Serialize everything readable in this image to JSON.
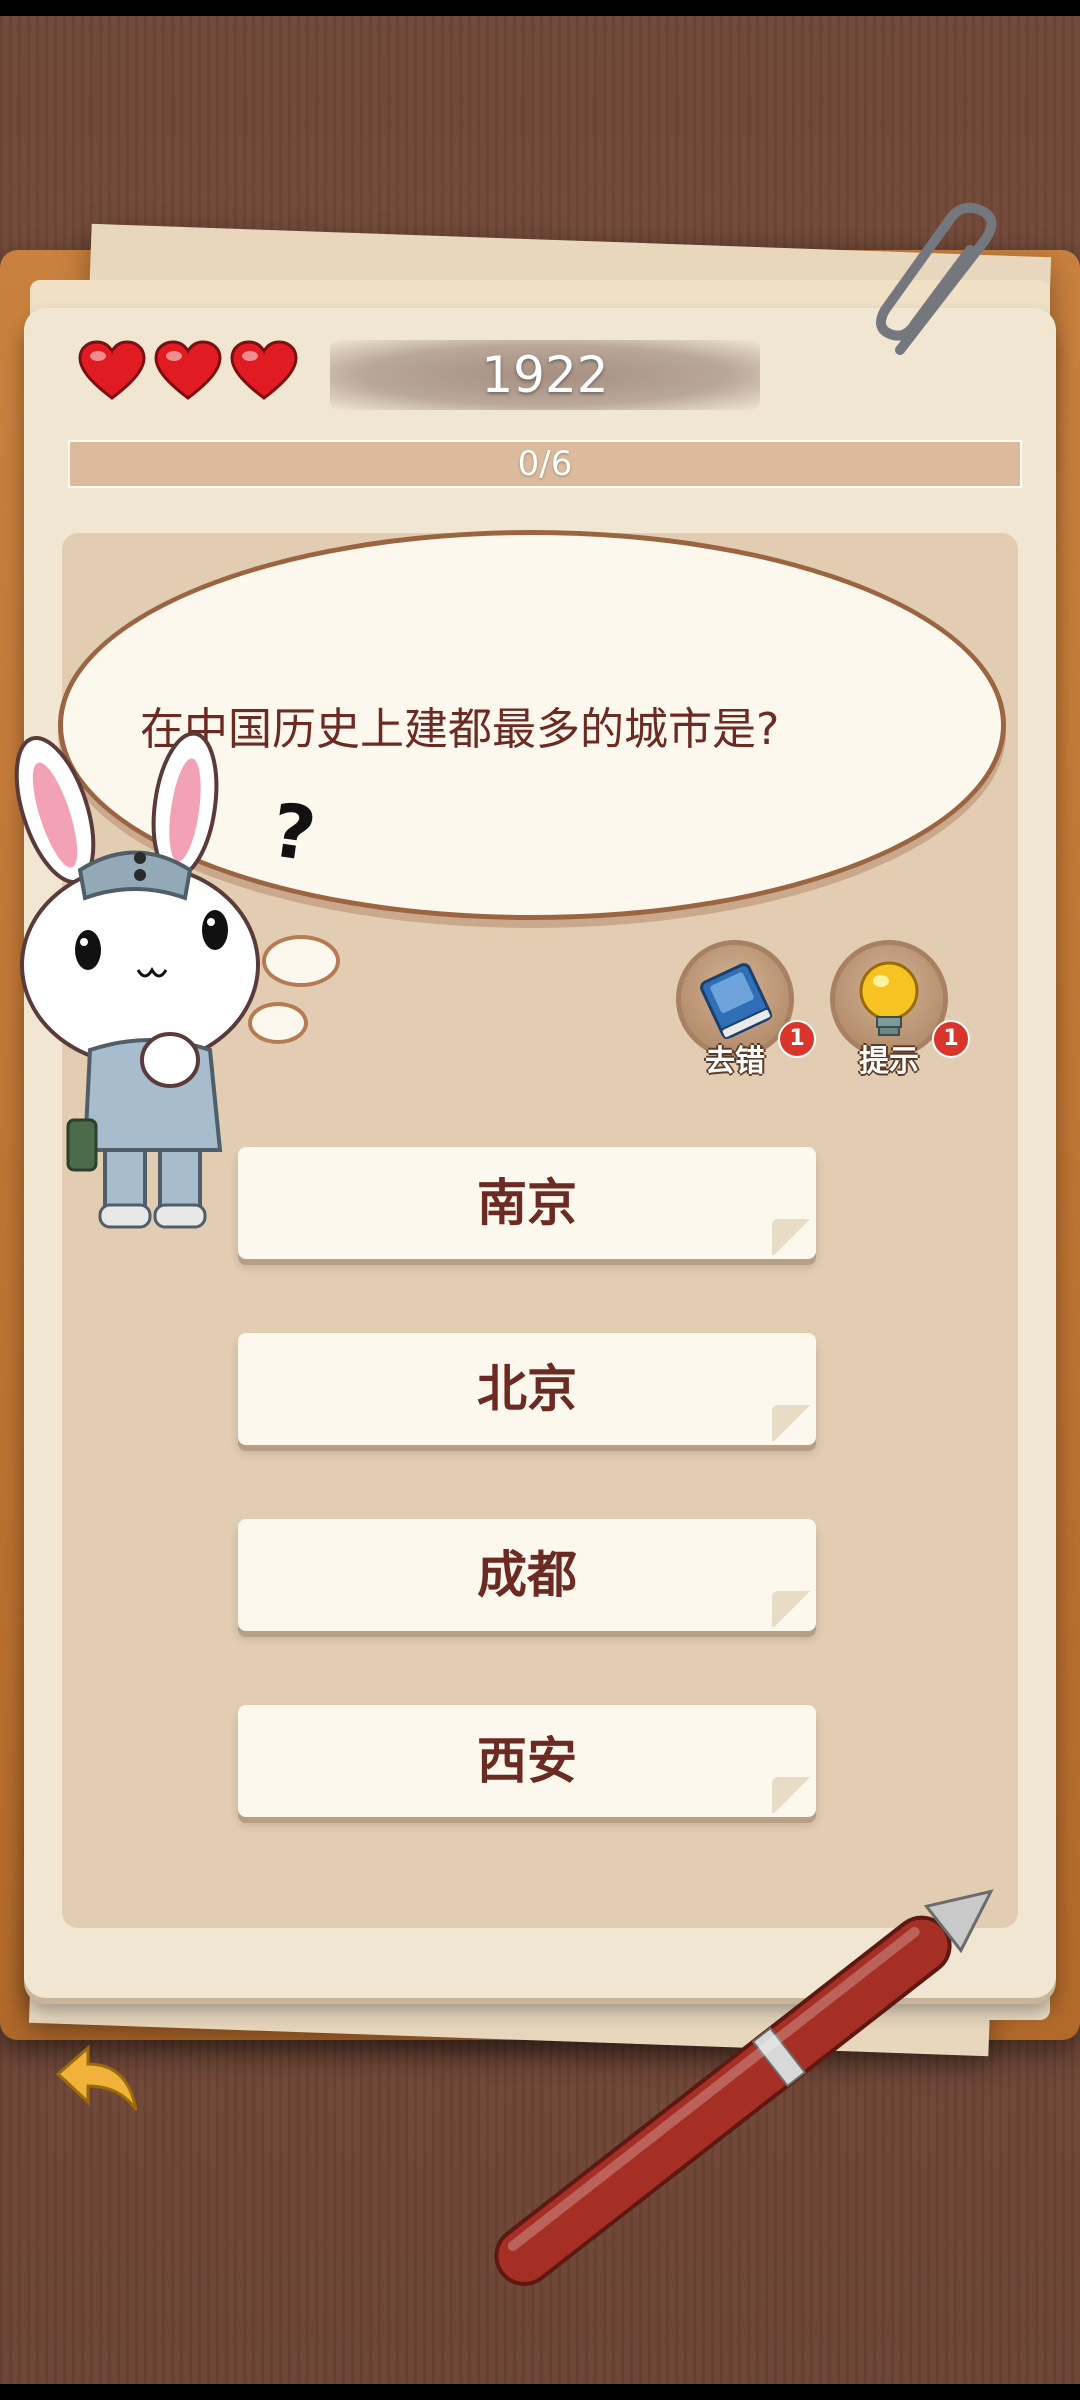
{
  "game": {
    "lives": 3,
    "score": "1922",
    "progress": {
      "text": "0/6",
      "fraction": 0.0
    },
    "question": "在中国历史上建都最多的城市是?",
    "question_mark": "?",
    "powerups": [
      {
        "label": "去错",
        "count": "1",
        "icon": "book-icon"
      },
      {
        "label": "提示",
        "count": "1",
        "icon": "lightbulb-icon"
      }
    ],
    "answers": [
      "南京",
      "北京",
      "成都",
      "西安"
    ]
  },
  "colors": {
    "accent_text": "#6b2a22",
    "heart": "#e11b22",
    "badge": "#d9352b"
  }
}
